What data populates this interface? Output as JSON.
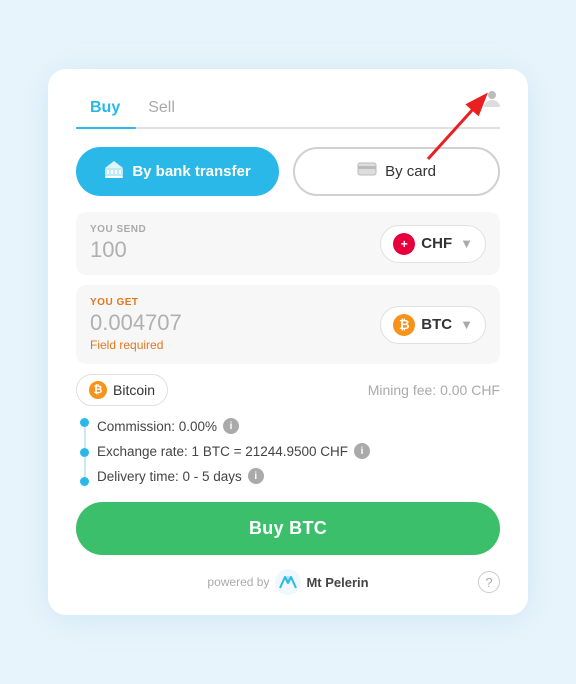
{
  "tabs": {
    "buy_label": "Buy",
    "sell_label": "Sell",
    "active": "buy"
  },
  "payment": {
    "bank_label": "By bank transfer",
    "card_label": "By card"
  },
  "send": {
    "label": "YOU SEND",
    "value": "100",
    "currency": "CHF",
    "symbol": "+"
  },
  "get": {
    "label": "YOU GET",
    "value": "0.004707",
    "currency": "BTC",
    "error": "Field required"
  },
  "bitcoin_row": {
    "label": "Bitcoin",
    "mining_fee": "Mining fee: 0.00 CHF"
  },
  "details": {
    "commission": "Commission: 0.00%",
    "exchange_rate": "Exchange rate: 1 BTC = 21244.9500 CHF",
    "delivery_time": "Delivery time: 0 - 5 days"
  },
  "buy_button": "Buy BTC",
  "footer": {
    "powered_by": "powered by",
    "brand": "Mt\nPelerin"
  },
  "icons": {
    "bank": "🏦",
    "card": "💳",
    "profile": "person",
    "info": "i",
    "help": "?"
  }
}
